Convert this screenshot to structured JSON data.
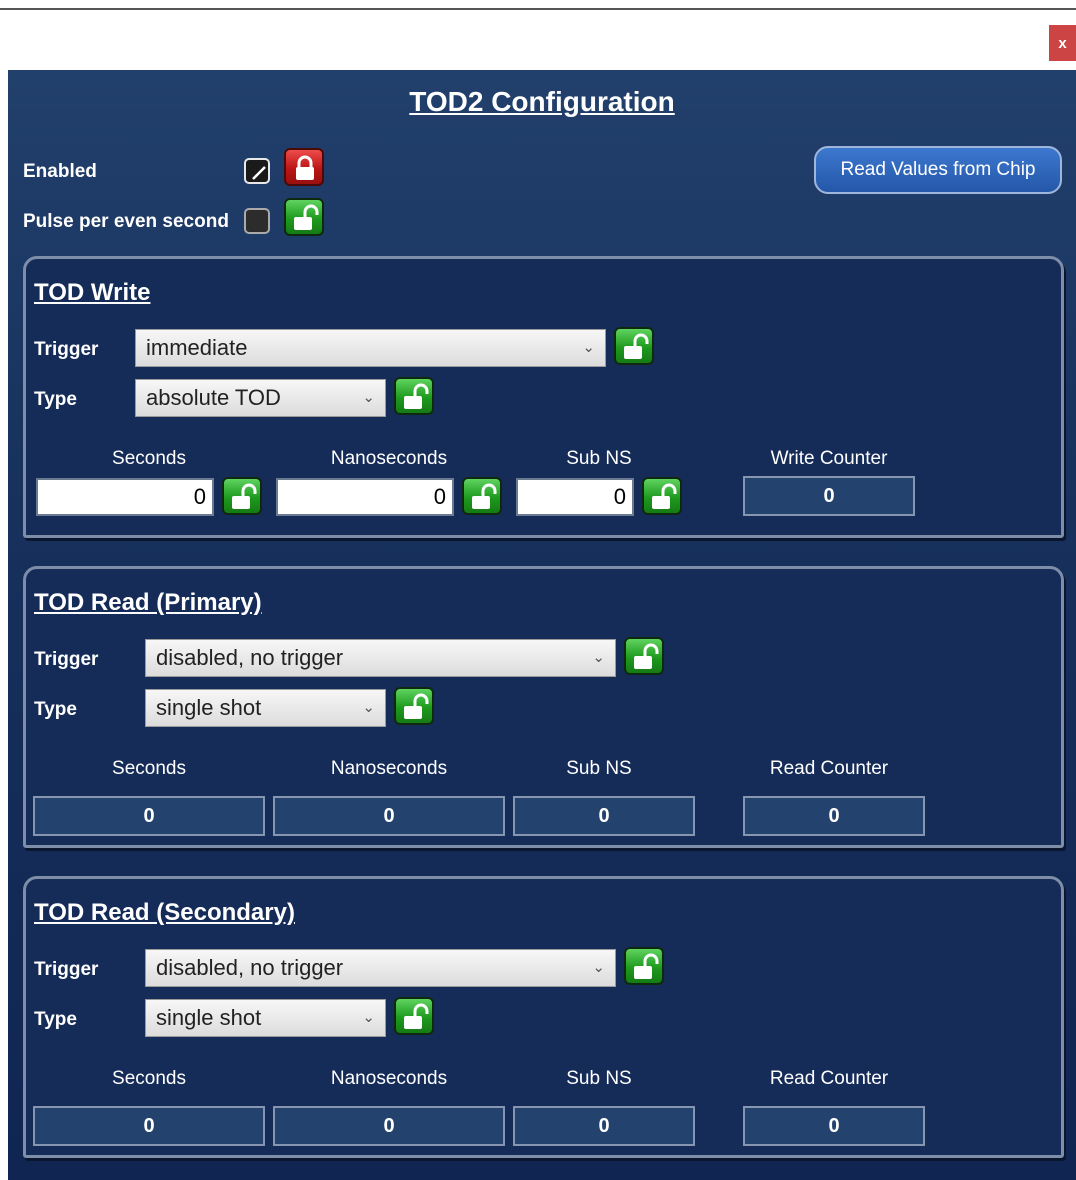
{
  "window": {
    "close_label": "x"
  },
  "title": "TOD2 Configuration",
  "top": {
    "enabled_label": "Enabled",
    "pulse_label": "Pulse per even second",
    "read_button_label": "Read Values from Chip"
  },
  "tod_write": {
    "title": "TOD Write",
    "trigger_label": "Trigger",
    "trigger_value": "immediate",
    "type_label": "Type",
    "type_value": "absolute TOD",
    "seconds_label": "Seconds",
    "nanoseconds_label": "Nanoseconds",
    "subns_label": "Sub NS",
    "counter_label": "Write Counter",
    "seconds_value": "0",
    "nanoseconds_value": "0",
    "subns_value": "0",
    "counter_value": "0"
  },
  "tod_read_primary": {
    "title": "TOD Read (Primary)",
    "trigger_label": "Trigger",
    "trigger_value": "disabled, no trigger",
    "type_label": "Type",
    "type_value": "single shot",
    "seconds_label": "Seconds",
    "nanoseconds_label": "Nanoseconds",
    "subns_label": "Sub NS",
    "counter_label": "Read Counter",
    "seconds_value": "0",
    "nanoseconds_value": "0",
    "subns_value": "0",
    "counter_value": "0"
  },
  "tod_read_secondary": {
    "title": "TOD Read (Secondary)",
    "trigger_label": "Trigger",
    "trigger_value": "disabled, no trigger",
    "type_label": "Type",
    "type_value": "single shot",
    "seconds_label": "Seconds",
    "nanoseconds_label": "Nanoseconds",
    "subns_label": "Sub NS",
    "counter_label": "Read Counter",
    "seconds_value": "0",
    "nanoseconds_value": "0",
    "subns_value": "0",
    "counter_value": "0"
  },
  "icons": {
    "chevron": "chevron-down-icon",
    "locked": "lock-closed-icon",
    "unlocked": "lock-open-icon",
    "checkmark": "checkmark-icon"
  },
  "colors": {
    "background": "#17305c",
    "lock_open": "#2fae2f",
    "lock_closed": "#cc1a1a",
    "accent_button": "#2f67bd"
  }
}
